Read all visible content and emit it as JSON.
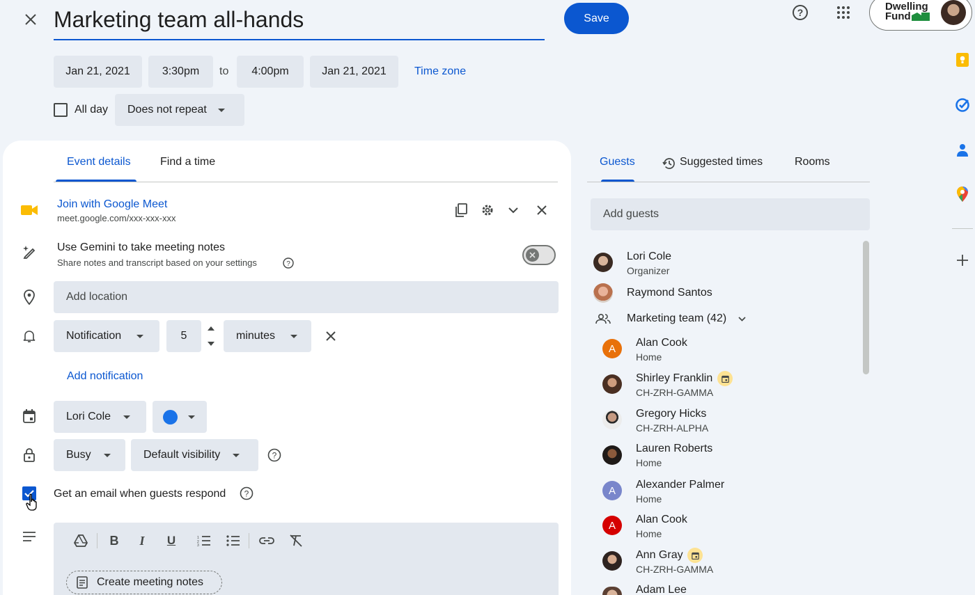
{
  "header": {
    "title": "Marketing team all-hands",
    "save_label": "Save",
    "account_brand_line1": "Dwelling",
    "account_brand_line2": "Fund"
  },
  "datetime": {
    "start_date": "Jan 21, 2021",
    "start_time": "3:30pm",
    "to_label": "to",
    "end_time": "4:00pm",
    "end_date": "Jan 21, 2021",
    "time_zone_label": "Time zone",
    "all_day_label": "All day",
    "repeat_value": "Does not repeat"
  },
  "tabs": {
    "event_details": "Event details",
    "find_a_time": "Find a time"
  },
  "meet": {
    "join_label": "Join with Google Meet",
    "url": "meet.google.com/xxx-xxx-xxx"
  },
  "gemini": {
    "title": "Use Gemini to take meeting notes",
    "subtitle": "Share notes and transcript based on your settings"
  },
  "location": {
    "placeholder": "Add location"
  },
  "notification": {
    "type": "Notification",
    "amount": "5",
    "unit": "minutes",
    "add_label": "Add notification"
  },
  "calendar": {
    "owner": "Lori Cole",
    "color": "#1a73e8"
  },
  "visibility": {
    "status": "Busy",
    "visibility": "Default visibility"
  },
  "email_option": {
    "label": "Get an email when guests respond",
    "checked": true
  },
  "description": {
    "create_notes_label": "Create meeting notes"
  },
  "right_tabs": {
    "guests": "Guests",
    "suggested": "Suggested times",
    "rooms": "Rooms"
  },
  "guests": {
    "add_placeholder": "Add guests",
    "organizer": {
      "name": "Lori Cole",
      "role": "Organizer"
    },
    "second": {
      "name": "Raymond Santos"
    },
    "group": {
      "name": "Marketing team (42)"
    },
    "members": [
      {
        "name": "Alan Cook",
        "sub": "Home",
        "initial": "A",
        "color": "#e8710a"
      },
      {
        "name": "Shirley Franklin",
        "sub": "CH-ZRH-GAMMA"
      },
      {
        "name": "Gregory Hicks",
        "sub": "CH-ZRH-ALPHA"
      },
      {
        "name": "Lauren Roberts",
        "sub": "Home"
      },
      {
        "name": "Alexander Palmer",
        "sub": "Home",
        "initial": "A",
        "color": "#7986cb"
      },
      {
        "name": "Alan Cook",
        "sub": "Home",
        "initial": "A",
        "color": "#d50000"
      },
      {
        "name": "Ann Gray",
        "sub": "CH-ZRH-GAMMA"
      },
      {
        "name": "Adam Lee",
        "sub": ""
      }
    ]
  },
  "colors": {
    "accent": "#0b57d0",
    "background": "#f0f4f9",
    "chip": "#e3e8ef"
  }
}
